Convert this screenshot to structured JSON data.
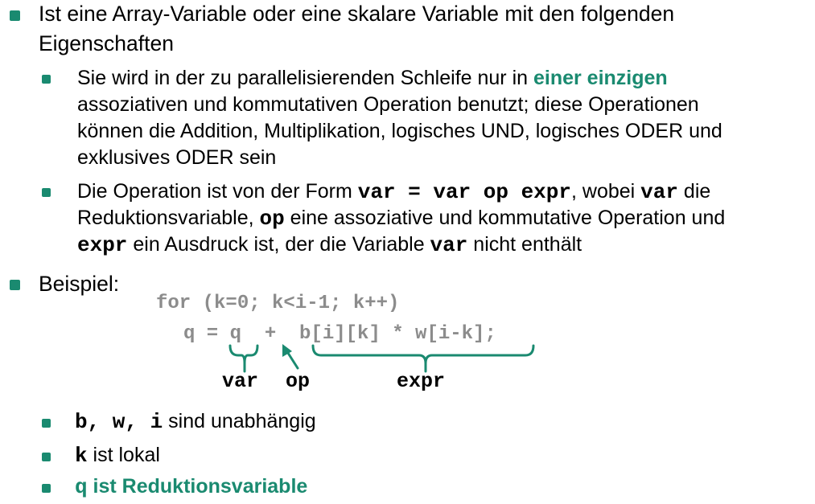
{
  "colors": {
    "accent": "#1a8a70",
    "code_gray": "#8c8c8c"
  },
  "item1": {
    "line1": "Ist eine Array-Variable oder eine skalare Variable mit den folgenden",
    "line2": "Eigenschaften"
  },
  "sub1": {
    "line1_pre": "Sie wird in der zu parallelisierenden Schleife nur in ",
    "line1_accent": "einer einzigen",
    "line2": "assoziativen und kommutativen Operation benutzt; diese Operationen",
    "line3": "können die Addition, Multiplikation, logisches UND, logisches ODER und",
    "line4": "exklusives ODER sein"
  },
  "sub2": {
    "l1_a": "Die Operation ist von der Form ",
    "l1_code": "var = var op expr",
    "l1_b": ", wobei ",
    "l1_var": "var",
    "l1_c": " die",
    "l2_a": "Reduktionsvariable, ",
    "l2_op": "op",
    "l2_b": " eine assoziative und kommutative Operation und",
    "l3_expr": "expr",
    "l3_a": " ein Ausdruck ist, der die Variable ",
    "l3_var": "var",
    "l3_b": " nicht enthält"
  },
  "item2": {
    "label": "Beispiel:"
  },
  "code": {
    "line1": "for (k=0; k<i-1; k++)",
    "line2": "q = q  +  b[i][k] * w[i-k];"
  },
  "annotations": {
    "var": "var",
    "op": "op",
    "expr": "expr"
  },
  "notes": [
    {
      "code": "b, w, i",
      "text": " sind unabhängig"
    },
    {
      "code": "k",
      "text": " ist lokal"
    },
    {
      "code": "q",
      "text": " ist Reduktionsvariable"
    }
  ]
}
